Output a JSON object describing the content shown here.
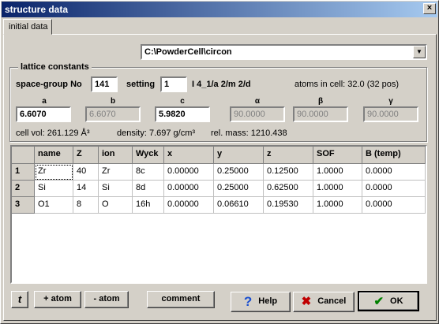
{
  "window": {
    "title": "structure data",
    "close_glyph": "×"
  },
  "tabs": [
    {
      "label": "initial data"
    }
  ],
  "file": {
    "path": "C:\\PowderCell\\circon",
    "dropdown_glyph": "▼"
  },
  "lattice": {
    "group_title": "lattice constants",
    "space_group_label": "space-group No",
    "space_group_value": "141",
    "setting_label": "setting",
    "setting_value": "1",
    "symbol": "I 4_1/a 2/m 2/d",
    "atoms_in_cell": "atoms in cell: 32.0  (32 pos)",
    "params": [
      {
        "name": "a",
        "value": "6.6070",
        "enabled": true
      },
      {
        "name": "b",
        "value": "6.6070",
        "enabled": false
      },
      {
        "name": "c",
        "value": "5.9820",
        "enabled": true
      },
      {
        "name": "α",
        "value": "90.0000",
        "enabled": false
      },
      {
        "name": "β",
        "value": "90.0000",
        "enabled": false
      },
      {
        "name": "γ",
        "value": "90.0000",
        "enabled": false
      }
    ],
    "cell_vol": "cell vol: 261.129 Å³",
    "density": "density: 7.697 g/cm³",
    "rel_mass": "rel. mass: 1210.438"
  },
  "table": {
    "columns": [
      "name",
      "Z",
      "ion",
      "Wyck",
      "x",
      "y",
      "z",
      "SOF",
      "B (temp)"
    ],
    "rows": [
      {
        "index": "1",
        "cells": [
          "Zr",
          "40",
          "Zr",
          "8c",
          "0.00000",
          "0.25000",
          "0.12500",
          "1.0000",
          "0.0000"
        ]
      },
      {
        "index": "2",
        "cells": [
          "Si",
          "14",
          "Si",
          "8d",
          "0.00000",
          "0.25000",
          "0.62500",
          "1.0000",
          "0.0000"
        ]
      },
      {
        "index": "3",
        "cells": [
          "O1",
          "8",
          "O",
          "16h",
          "0.00000",
          "0.06610",
          "0.19530",
          "1.0000",
          "0.0000"
        ]
      }
    ]
  },
  "buttons": {
    "transpose_glyph": "t",
    "add_atom": "+ atom",
    "remove_atom": "- atom",
    "comment": "comment",
    "help": "Help",
    "help_glyph": "?",
    "cancel": "Cancel",
    "cancel_glyph": "✖",
    "ok": "OK",
    "ok_glyph": "✔"
  },
  "colors": {
    "title_start": "#0a246a",
    "title_end": "#a6caf0",
    "help_icon": "#1a4fd0",
    "cancel_icon": "#c00000",
    "ok_icon": "#008000"
  }
}
